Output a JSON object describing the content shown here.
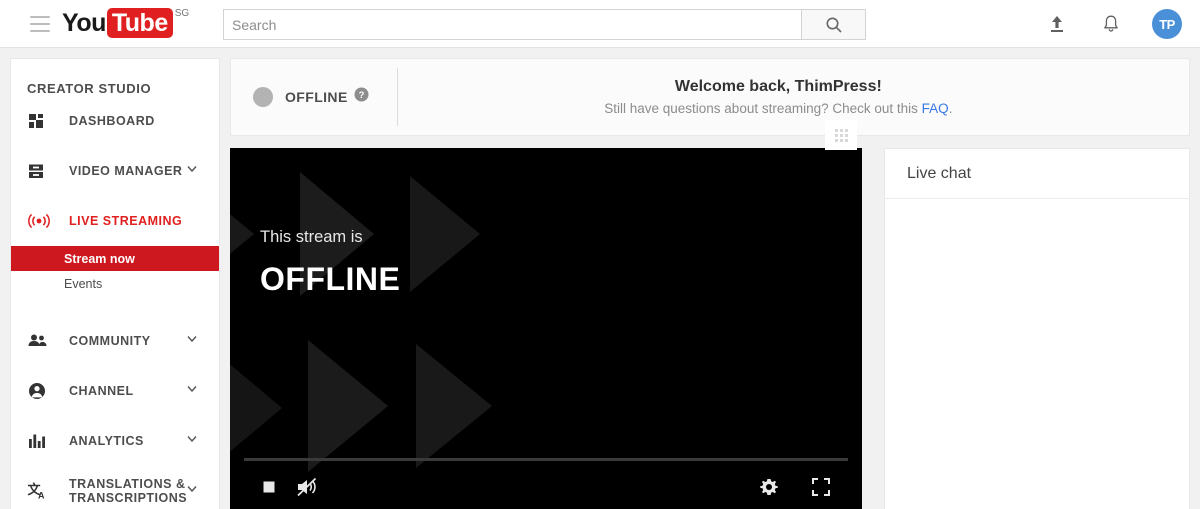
{
  "topbar": {
    "menu_icon": "hamburger-icon",
    "logo": {
      "you": "You",
      "tube": "Tube",
      "country_code": "SG"
    },
    "search": {
      "value": "",
      "placeholder": "Search",
      "icon": "search-icon"
    },
    "upload_icon": "upload-icon",
    "notifications_icon": "bell-icon",
    "avatar_initials": "TP"
  },
  "sidebar": {
    "title": "CREATOR STUDIO",
    "items": [
      {
        "label": "DASHBOARD",
        "icon": "dashboard-icon",
        "expandable": false,
        "active": false
      },
      {
        "label": "VIDEO MANAGER",
        "icon": "video-manager-icon",
        "expandable": true,
        "active": false
      },
      {
        "label": "LIVE STREAMING",
        "icon": "live-streaming-icon",
        "expandable": false,
        "active": true
      },
      {
        "label": "COMMUNITY",
        "icon": "community-icon",
        "expandable": true,
        "active": false
      },
      {
        "label": "CHANNEL",
        "icon": "channel-icon",
        "expandable": true,
        "active": false
      },
      {
        "label": "ANALYTICS",
        "icon": "analytics-icon",
        "expandable": true,
        "active": false
      },
      {
        "label": "TRANSLATIONS & TRANSCRIPTIONS",
        "icon": "translations-icon",
        "expandable": true,
        "active": false
      }
    ],
    "sub_items": [
      {
        "label": "Stream now",
        "selected": true
      },
      {
        "label": "Events",
        "selected": false
      }
    ]
  },
  "status": {
    "state_label": "OFFLINE",
    "indicator_color": "#b3b3b3",
    "help_icon": "help-icon"
  },
  "welcome": {
    "title": "Welcome back, ThimPress!",
    "subtitle_before": "Still have questions about streaming? Check out this ",
    "link_label": "FAQ",
    "subtitle_after": ".",
    "link_color": "#3b78e7"
  },
  "drag_handle": {
    "icon": "drag-handle-icon"
  },
  "player": {
    "line1": "This stream is",
    "line2": "OFFLINE",
    "controls": {
      "stop_icon": "stop-icon",
      "mute_icon": "volume-muted-icon",
      "settings_icon": "gear-icon",
      "fullscreen_icon": "fullscreen-icon"
    }
  },
  "chat": {
    "title": "Live chat"
  }
}
